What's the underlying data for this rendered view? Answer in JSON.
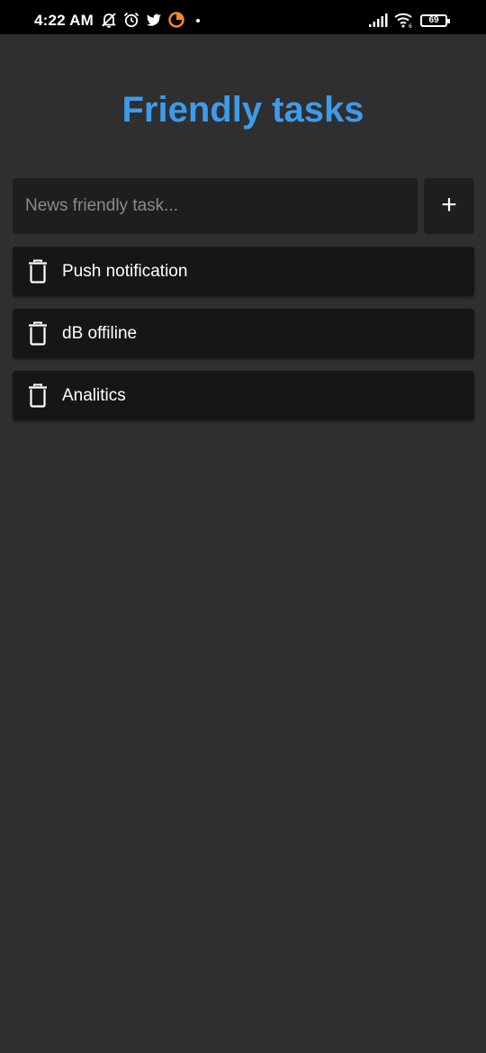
{
  "status_bar": {
    "time": "4:22 AM",
    "battery": "69",
    "icons": [
      "notifications-off-icon",
      "alarm-icon",
      "twitter-icon",
      "pie-app-icon",
      "signal-icon",
      "wifi-icon",
      "battery-icon"
    ]
  },
  "app": {
    "title": "Friendly tasks",
    "accent_color": "#3d9be9"
  },
  "new_task": {
    "placeholder": "News friendly task...",
    "value": "",
    "add_label": "+"
  },
  "tasks": [
    {
      "label": "Push notification"
    },
    {
      "label": "dB offiline"
    },
    {
      "label": "Analitics"
    }
  ]
}
